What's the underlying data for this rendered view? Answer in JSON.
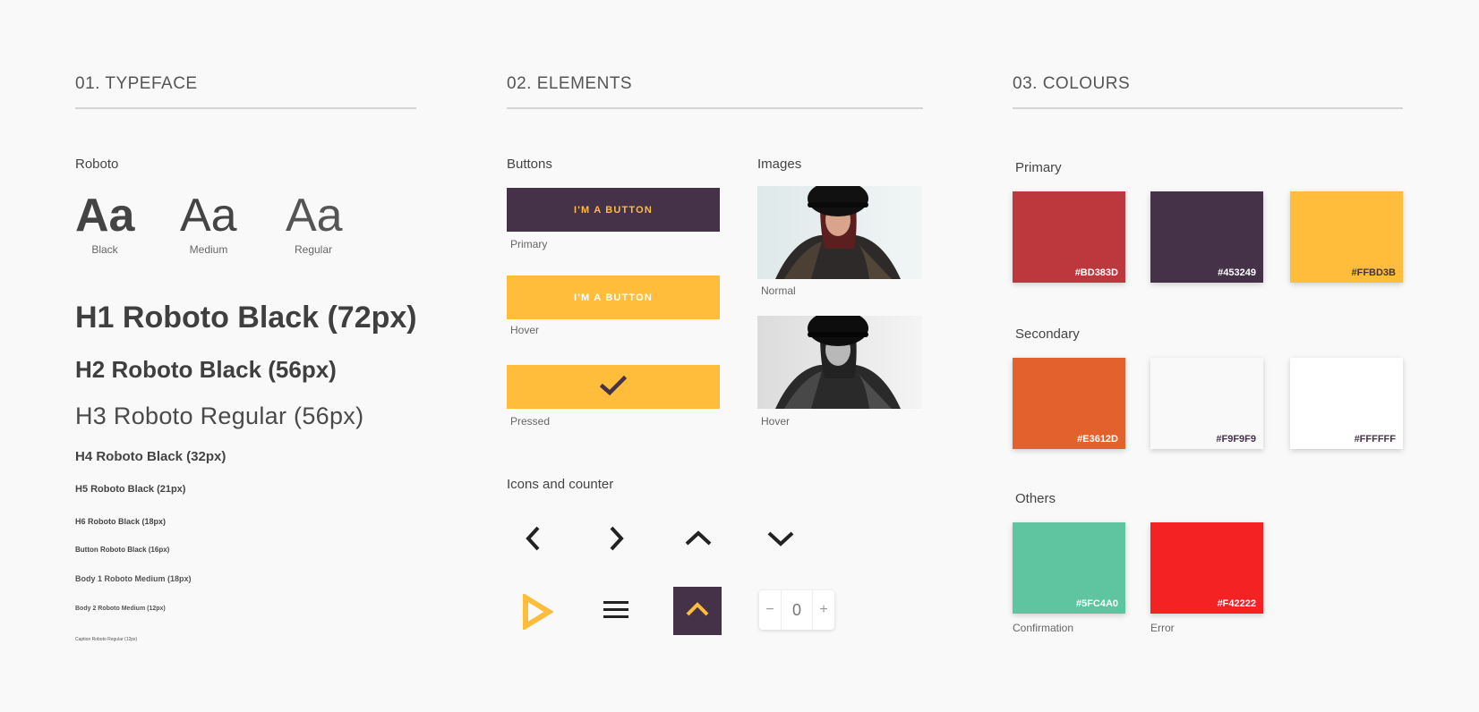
{
  "typeface": {
    "section_title": "01. TYPEFACE",
    "font_name": "Roboto",
    "samples": [
      {
        "glyph": "Aa",
        "label": "Black"
      },
      {
        "glyph": "Aa",
        "label": "Medium"
      },
      {
        "glyph": "Aa",
        "label": "Regular"
      }
    ],
    "scale": {
      "h1": "H1 Roboto Black (72px)",
      "h2": "H2 Roboto Black (56px)",
      "h3": "H3 Roboto Regular (56px)",
      "h4": "H4 Roboto Black (32px)",
      "h5": "H5 Roboto Black (21px)",
      "h6": "H6 Roboto Black (18px)",
      "button": "Button Roboto Black (16px)",
      "body1": "Body 1 Roboto Medium (18px)",
      "body2": "Body 2 Roboto Medium (12px)",
      "caption": "Caption Roboto Regular (12px)"
    }
  },
  "elements": {
    "section_title": "02. ELEMENTS",
    "buttons": {
      "heading": "Buttons",
      "primary_label": "I'M A BUTTON",
      "primary_caption": "Primary",
      "hover_label": "I'M A BUTTON",
      "hover_caption": "Hover",
      "pressed_icon": "check-icon",
      "pressed_caption": "Pressed"
    },
    "images": {
      "heading": "Images",
      "normal_caption": "Normal",
      "hover_caption": "Hover"
    },
    "icons": {
      "heading": "Icons and counter",
      "row1": [
        "chevron-left-icon",
        "chevron-right-icon",
        "chevron-up-icon",
        "chevron-down-icon"
      ],
      "row2": [
        "play-icon",
        "menu-icon",
        "scroll-top-icon"
      ],
      "counter": {
        "minus": "−",
        "value": "0",
        "plus": "+"
      }
    }
  },
  "colours": {
    "section_title": "03. COLOURS",
    "primary": {
      "heading": "Primary",
      "swatches": [
        {
          "hex": "#BD383D",
          "text_color": "#FFFFFF"
        },
        {
          "hex": "#453249",
          "text_color": "#FFFFFF"
        },
        {
          "hex": "#FFBD3B",
          "text_color": "#453249"
        }
      ]
    },
    "secondary": {
      "heading": "Secondary",
      "swatches": [
        {
          "hex": "#E3612D",
          "text_color": "#FFFFFF"
        },
        {
          "hex": "#F9F9F9",
          "text_color": "#453249"
        },
        {
          "hex": "#FFFFFF",
          "text_color": "#453249"
        }
      ]
    },
    "others": {
      "heading": "Others",
      "swatches": [
        {
          "hex": "#5FC4A0",
          "text_color": "#FFFFFF",
          "caption": "Confirmation"
        },
        {
          "hex": "#F42222",
          "text_color": "#FFFFFF",
          "caption": "Error"
        }
      ]
    }
  }
}
